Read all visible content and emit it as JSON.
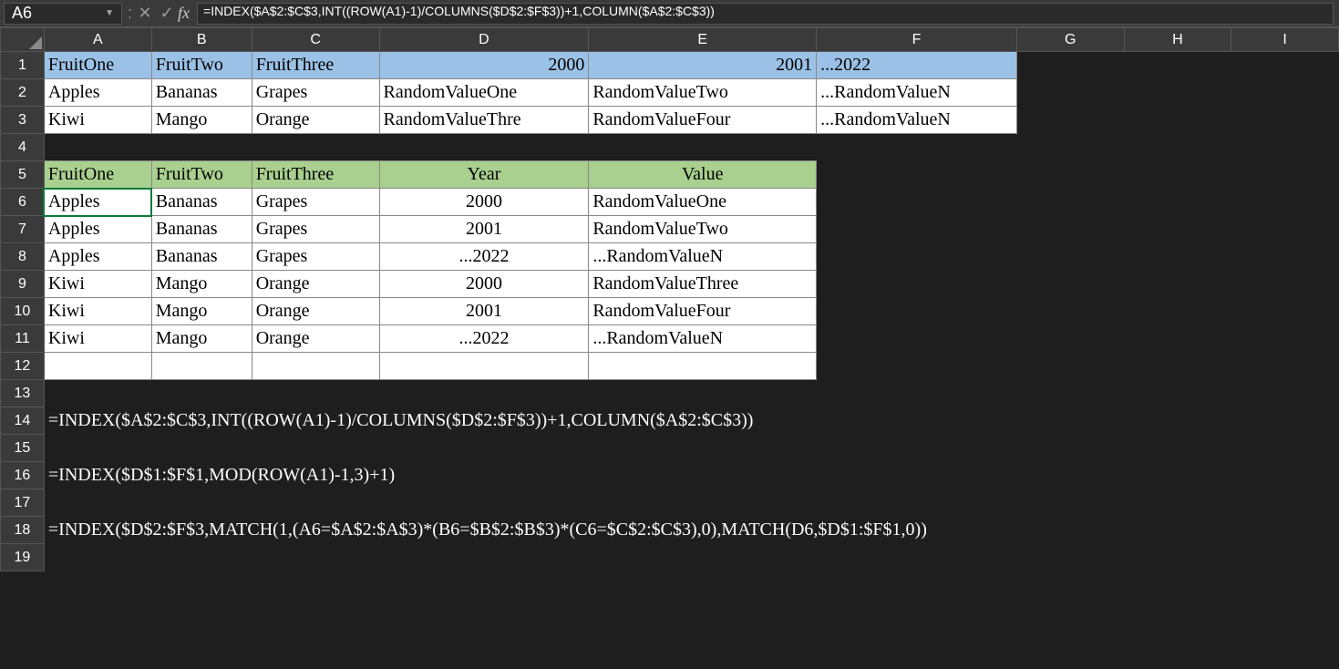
{
  "formula_bar": {
    "cell_ref": "A6",
    "formula": "=INDEX($A$2:$C$3,INT((ROW(A1)-1)/COLUMNS($D$2:$F$3))+1,COLUMN($A$2:$C$3))",
    "fx_label": "fx",
    "cancel": "✕",
    "enter": "✓",
    "sep": ":"
  },
  "columns": [
    "A",
    "B",
    "C",
    "D",
    "E",
    "F",
    "G",
    "H",
    "I"
  ],
  "rows": [
    "1",
    "2",
    "3",
    "4",
    "5",
    "6",
    "7",
    "8",
    "9",
    "10",
    "11",
    "12",
    "13",
    "14",
    "15",
    "16",
    "17",
    "18",
    "19"
  ],
  "cells": {
    "r1": {
      "A": "FruitOne",
      "B": "FruitTwo",
      "C": "FruitThree",
      "D": "2000",
      "E": "2001",
      "F": "...2022"
    },
    "r2": {
      "A": "Apples",
      "B": "Bananas",
      "C": "Grapes",
      "D": "RandomValueOne",
      "E": "RandomValueTwo",
      "F": "...RandomValueN"
    },
    "r3": {
      "A": "Kiwi",
      "B": "Mango",
      "C": "Orange",
      "D": "RandomValueThre",
      "E": "RandomValueFour",
      "F": "...RandomValueN"
    },
    "r5": {
      "A": "FruitOne",
      "B": "FruitTwo",
      "C": "FruitThree",
      "D": "Year",
      "E": "Value"
    },
    "r6": {
      "A": "Apples",
      "B": "Bananas",
      "C": "Grapes",
      "D": "2000",
      "E": "RandomValueOne"
    },
    "r7": {
      "A": "Apples",
      "B": "Bananas",
      "C": "Grapes",
      "D": "2001",
      "E": "RandomValueTwo"
    },
    "r8": {
      "A": "Apples",
      "B": "Bananas",
      "C": "Grapes",
      "D": "...2022",
      "E": "...RandomValueN"
    },
    "r9": {
      "A": "Kiwi",
      "B": "Mango",
      "C": "Orange",
      "D": "2000",
      "E": "RandomValueThree"
    },
    "r10": {
      "A": "Kiwi",
      "B": "Mango",
      "C": "Orange",
      "D": "2001",
      "E": "RandomValueFour"
    },
    "r11": {
      "A": "Kiwi",
      "B": "Mango",
      "C": "Orange",
      "D": "...2022",
      "E": "...RandomValueN"
    }
  },
  "formulas": {
    "f14": "=INDEX($A$2:$C$3,INT((ROW(A1)-1)/COLUMNS($D$2:$F$3))+1,COLUMN($A$2:$C$3))",
    "f16": "=INDEX($D$1:$F$1,MOD(ROW(A1)-1,3)+1)",
    "f18": "=INDEX($D$2:$F$3,MATCH(1,(A6=$A$2:$A$3)*(B6=$B$2:$B$3)*(C6=$C$2:$C$3),0),MATCH(D6,$D$1:$F$1,0))"
  }
}
